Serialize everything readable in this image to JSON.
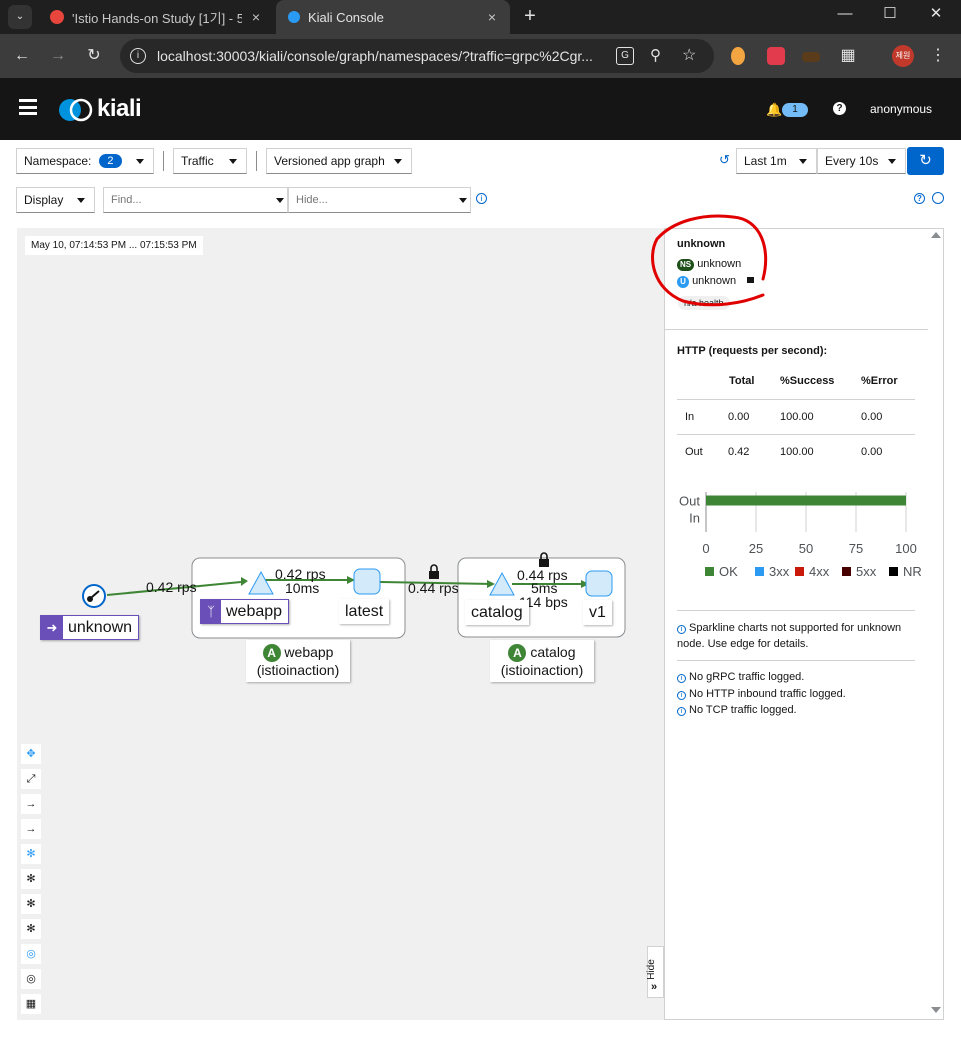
{
  "browser": {
    "tabs": [
      {
        "title": "'Istio Hands-on Study [1기] - 5",
        "close": "×"
      },
      {
        "title": "Kiali Console",
        "close": "×"
      }
    ],
    "new_tab": "+",
    "url": "localhost:30003/kiali/console/graph/namespaces/?traffic=grpc%2Cgr...",
    "profile": "제원"
  },
  "header": {
    "logo_text": "kiali",
    "notification_count": "1",
    "user": "anonymous"
  },
  "filters": {
    "namespace_label": "Namespace:",
    "namespace_count": "2",
    "traffic_label": "Traffic",
    "graph_type": "Versioned app graph",
    "duration": "Last 1m",
    "refresh": "Every 10s",
    "display_label": "Display",
    "find_placeholder": "Find...",
    "hide_placeholder": "Hide..."
  },
  "graph": {
    "timestamp": "May 10, 07:14:53 PM ... 07:15:53 PM",
    "hide_label": "Hide",
    "nodes": {
      "unknown": "unknown",
      "webapp": "webapp",
      "latest": "latest",
      "catalog": "catalog",
      "v1": "v1",
      "webapp_box_title": "webapp",
      "webapp_box_ns": "(istioinaction)",
      "catalog_box_title": "catalog",
      "catalog_box_ns": "(istioinaction)",
      "app_badge": "A"
    },
    "edges": {
      "unknown_to_webapp": "0.42 rps",
      "webapp_to_latest_rps": "0.42 rps",
      "webapp_to_latest_ms": "10ms",
      "latest_to_catalog": "0.44 rps",
      "catalog_to_v1_rps": "0.44 rps",
      "catalog_to_v1_ms": "5ms",
      "catalog_to_v1_bps": "114 bps"
    }
  },
  "panel": {
    "title": "unknown",
    "ns_badge": "NS",
    "ns_value": "unknown",
    "u_badge": "U",
    "u_value": "unknown",
    "health": "n/a health",
    "http_title": "HTTP (requests per second):",
    "table": {
      "headers": [
        "",
        "Total",
        "%Success",
        "%Error"
      ],
      "rows": [
        [
          "In",
          "0.00",
          "100.00",
          "0.00"
        ],
        [
          "Out",
          "0.42",
          "100.00",
          "0.00"
        ]
      ]
    },
    "sparkline_note": "Sparkline charts not supported for unknown node. Use edge for details.",
    "no_grpc": "No gRPC traffic logged.",
    "no_http": "No HTTP inbound traffic logged.",
    "no_tcp": "No TCP traffic logged."
  },
  "chart_data": {
    "type": "bar",
    "orientation": "horizontal",
    "categories": [
      "Out",
      "In"
    ],
    "series": [
      {
        "name": "OK",
        "color": "#3e8635",
        "values": [
          100,
          0
        ]
      },
      {
        "name": "3xx",
        "color": "#2b9af3",
        "values": [
          0,
          0
        ]
      },
      {
        "name": "4xx",
        "color": "#c9190b",
        "values": [
          0,
          0
        ]
      },
      {
        "name": "5xx",
        "color": "#470000",
        "values": [
          0,
          0
        ]
      },
      {
        "name": "NR",
        "color": "#000000",
        "values": [
          0,
          0
        ]
      }
    ],
    "xticks": [
      "0",
      "25",
      "50",
      "75",
      "100"
    ],
    "xlim": [
      0,
      100
    ],
    "legend_position": "bottom"
  },
  "colors": {
    "accent": "#0066cc",
    "success": "#3e8635",
    "annotation_red": "#e00000",
    "app_badge": "#3e8635",
    "workload_purple": "#6a4fb8"
  }
}
